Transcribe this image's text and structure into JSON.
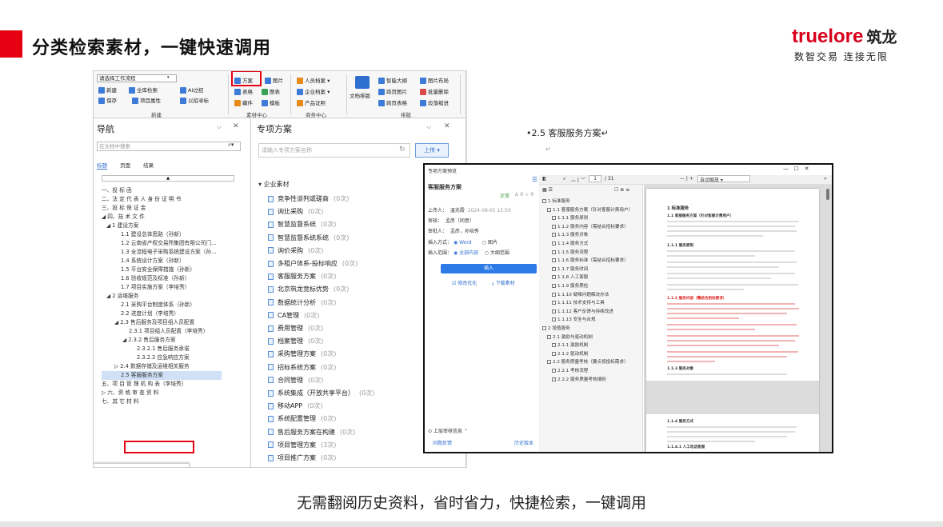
{
  "slide": {
    "title": "分类检索素材，一键快速调用",
    "caption": "无需翻阅历史资料，省时省力，快捷检索，一键调用",
    "logo_en": "truelore",
    "logo_cn": "筑龙",
    "logo_slogan": "数智交易 连接无限",
    "accent_color": "#e60012"
  },
  "ribbon": {
    "workflow_placeholder": "请选择工作流程",
    "new_label": "新建",
    "fullsearch_label": "全库检索",
    "ai_label": "AI过招",
    "save_label": "保存",
    "project_attr_label": "项目属性",
    "history_label": "以招寻标",
    "grp_new": "新建",
    "plan_label": "方案",
    "image_label": "图片",
    "table_label": "表格",
    "chart_label": "图表",
    "seal_label": "藏件",
    "template_label": "模板",
    "grp_material": "素材中心",
    "personnel_label": "人员档案",
    "enterprise_label": "企业档案",
    "product_label": "产品证照",
    "grp_business": "商务中心",
    "doc_format_label": "文档排版",
    "smart_outline_label": "智能大纲",
    "cross_img_label": "跨页图片",
    "cross_table_label": "跨页表格",
    "img_layout_label": "图片布局",
    "batch_delete_label": "批量删除",
    "para_indent_label": "段落缩进",
    "grp_layout": "排版",
    "history_doc_label": "历史文档",
    "std_check_label": "标准规范",
    "quick_doc_label": "文件速递",
    "grp_doc": "文档中心",
    "market_label": "市场\n开发",
    "bid_project_label": "投标\n项目",
    "compete_label": "竞对\n分析",
    "bid_review_label": "标书审批",
    "edit_bid_label": "编标盯控",
    "grp_project": "项目管理",
    "manage_label": "管理",
    "my_label": "我的",
    "message_label": "消息",
    "guide_label": "新手\n指引",
    "grp_user": "用户中心"
  },
  "nav": {
    "title": "导航",
    "search_placeholder": "在文档中搜索",
    "tabs": [
      "标题",
      "页面",
      "结果"
    ],
    "items": [
      "一、投 标 函",
      "二、法 定 代 表 人 身 份 证 明 书",
      "三、投 标 保 证 金",
      "◢ 四、技 术 文 件",
      "◢ 1 建设方案",
      "1.1 建设总体思路（孙新）",
      "1.2 云南省产权交易所集团有限公司门...",
      "1.3 全流程电子采购系统建设方案（孙...",
      "1.4 系统设计方案（孙新）",
      "1.5 平台安全保障措施（孙新）",
      "1.6 验收规范及标准（孙新）",
      "1.7 项目实施方案（李培秀）",
      "◢ 2 运维服务",
      "2.1 采购平台制度体系（孙新）",
      "2.2 进度计划（李培秀）",
      "◢ 2.3 售后服务及项目组人员配置",
      "2.3.1 项目组人员配置（李培秀）",
      "◢ 2.3.2 售后服务方案",
      "2.3.2.1 售后服务承诺",
      "2.3.2.2 应急响应方案",
      "▷ 2.4 数据存储及运维相关服务",
      "2.5 客服服务方案",
      "五、项 目 管 理 机 构 表（李培秀）",
      "▷ 六、资 格 审 查 资 料",
      "七、其 它 材 料"
    ]
  },
  "special": {
    "title": "专项方案",
    "search_placeholder": "请输入专项方案名称",
    "upload_label": "上传",
    "category": "企业素材",
    "items": [
      {
        "name": "竞争性谈判或磋商",
        "count": "(0次)"
      },
      {
        "name": "询比采购",
        "count": "(0次)"
      },
      {
        "name": "智慧监督系统",
        "count": "(0次)"
      },
      {
        "name": "智慧监督系统系统",
        "count": "(0次)"
      },
      {
        "name": "询价采购",
        "count": "(0次)"
      },
      {
        "name": "多租户体系-投标响应",
        "count": "(0次)"
      },
      {
        "name": "客服服务方案",
        "count": "(0次)"
      },
      {
        "name": "北京筑龙竞标优势",
        "count": "(0次)"
      },
      {
        "name": "数据统计分析",
        "count": "(0次)"
      },
      {
        "name": "CA管理",
        "count": "(0次)"
      },
      {
        "name": "费用管理",
        "count": "(0次)"
      },
      {
        "name": "档案管理",
        "count": "(0次)"
      },
      {
        "name": "采购管理方案",
        "count": "(0次)"
      },
      {
        "name": "招标系统方案",
        "count": "(0次)"
      },
      {
        "name": "合同管理",
        "count": "(0次)"
      },
      {
        "name": "系统集成（开放共享平台）",
        "count": "(0次)"
      },
      {
        "name": "移动APP",
        "count": "(0次)"
      },
      {
        "name": "系统配置管理",
        "count": "(0次)"
      },
      {
        "name": "售后服务方案在构建",
        "count": "(0次)"
      },
      {
        "name": "项目管理方案",
        "count": "(3次)"
      },
      {
        "name": "项目推广方案",
        "count": "(0次)"
      }
    ]
  },
  "doc": {
    "heading": "•2.5 客服服务方案↵"
  },
  "popup": {
    "window_title": "专项方案预览",
    "plan_name": "客服服务方案",
    "status": "正常",
    "likes": "0",
    "stars": "0",
    "uploader_label": "上传人：",
    "uploader": "温兆霞",
    "upload_time": "2024-08-05 15:50",
    "reviewer_label": "审核：",
    "reviewer": "孟彦（同意）",
    "approver_label": "审批人：",
    "approver": "孟彦，孙培秀",
    "insert_mode_label": "插入方式：",
    "insert_word": "Word",
    "insert_image": "图片",
    "insert_range_label": "插入范围：",
    "range_all": "全部内容",
    "range_outline": "大纲范围",
    "insert_button": "插入",
    "modify_link": "修改优化",
    "download_link": "下载素材",
    "review_info": "上层审核信息",
    "feedback_link": "问题反馈",
    "history_link": "历史版本",
    "page_num": "1",
    "page_total": "/ 31",
    "zoom": "自动缩放",
    "toc": [
      "1 标准服务",
      "1.1 客服服务方案（针对客服计费用户）",
      "1.1.1 服务原则",
      "1.1.2 服务内容（需结合招标要求）",
      "1.1.3 服务对象",
      "1.1.4 服务方式",
      "1.1.5 服务流程",
      "1.1.6 服务标准（需结合招标要求）",
      "1.1.7 服务时间",
      "1.1.8 人工客服",
      "1.1.9 服务质检",
      "1.1.10 疑难问题解决办法",
      "1.1.11 技术支持与工具",
      "1.1.12 客户反馈与持续改进",
      "1.1.13 安全与合规",
      "2 增值服务",
      "2.1 激励与驱动机制",
      "2.1.1 激励机制",
      "2.1.2 驱动机制",
      "2.2 服务质量考核（要点按投标需求）",
      "2.2.1 考核流程",
      "2.2.2 服务质量考核细则"
    ],
    "page_heading": "1 标准服务",
    "page_sub1": "1.1 客服服务方案（针对客服计费用户）",
    "page_s111": "1.1.1 服务原则",
    "page_s112": "1.1.2 服务内容（需结合招标要求）",
    "page_s113": "1.1.3 服务对象",
    "page_s114": "1.1.4 服务方式",
    "page_s1141": "1.1.4.1 人工电话客服"
  }
}
